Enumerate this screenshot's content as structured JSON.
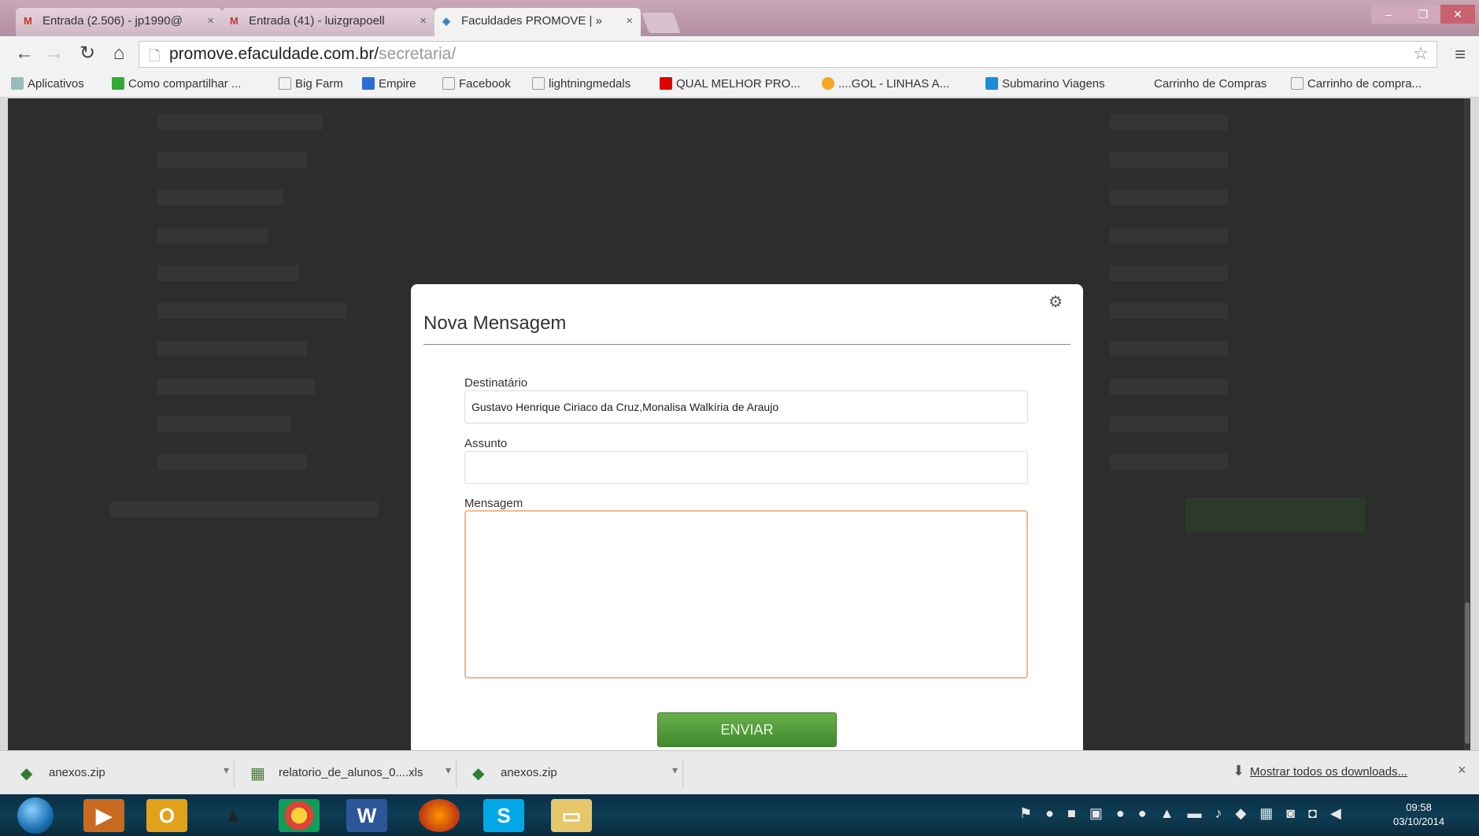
{
  "browser": {
    "tabs": [
      {
        "label": "Entrada (2.506) - jp1990@",
        "active": false
      },
      {
        "label": "Entrada (41) - luizgrapoell",
        "active": false
      },
      {
        "label": "Faculdades PROMOVE | »",
        "active": true
      }
    ],
    "url": {
      "host": "promove.efaculdade.com.br/",
      "path": "secretaria/"
    },
    "bookmarks": [
      "Aplicativos",
      "Como compartilhar ...",
      "Big Farm",
      "Empire",
      "Facebook",
      "lightningmedals",
      "QUAL MELHOR PRO...",
      "....GOL - LINHAS A...",
      "Submarino Viagens",
      "Carrinho de Compras",
      "Carrinho de compra..."
    ]
  },
  "modal": {
    "title": "Nova Mensagem",
    "fields": {
      "recipient_label": "Destinatário",
      "recipient_value": "Gustavo Henrique Ciriaco da Cruz,Monalisa Walkíria de Araujo",
      "subject_label": "Assunto",
      "subject_value": "",
      "message_label": "Mensagem",
      "message_value": ""
    },
    "send_label": "ENVIAR"
  },
  "downloads": {
    "items": [
      "anexos.zip",
      "relatorio_de_alunos_0....xls",
      "anexos.zip"
    ],
    "show_all_label": "Mostrar todos os downloads..."
  },
  "taskbar": {
    "time": "09:58",
    "date": "03/10/2014"
  },
  "colors": {
    "send_button": "#4e9a3a",
    "overlay": "#2d2d2d",
    "textarea_border": "#f0b892"
  }
}
